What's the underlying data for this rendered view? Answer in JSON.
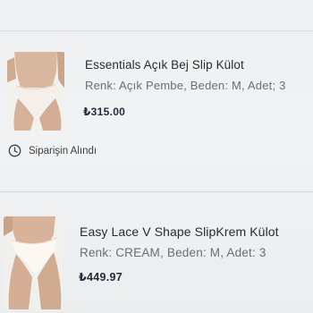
{
  "orders": [
    {
      "name": "Essentials Açık Bej Slip Külot",
      "details": "Renk: Açık Pembe, Beden: M, Adet; 3",
      "price": "₺315.00",
      "thumbnail": "underwear-model-photo"
    },
    {
      "name": "Easy Lace V Shape SlipKrem Külot",
      "details": "Renk: CREAM, Beden: M, Adet: 3",
      "price": "₺449.97",
      "thumbnail": "underwear-model-photo"
    }
  ],
  "status": {
    "label": "Siparişin Alındı",
    "icon": "clock-check-icon"
  },
  "colors": {
    "background": "#eef0f2",
    "price": "#1f2a3a",
    "meta": "#6b6e72"
  }
}
